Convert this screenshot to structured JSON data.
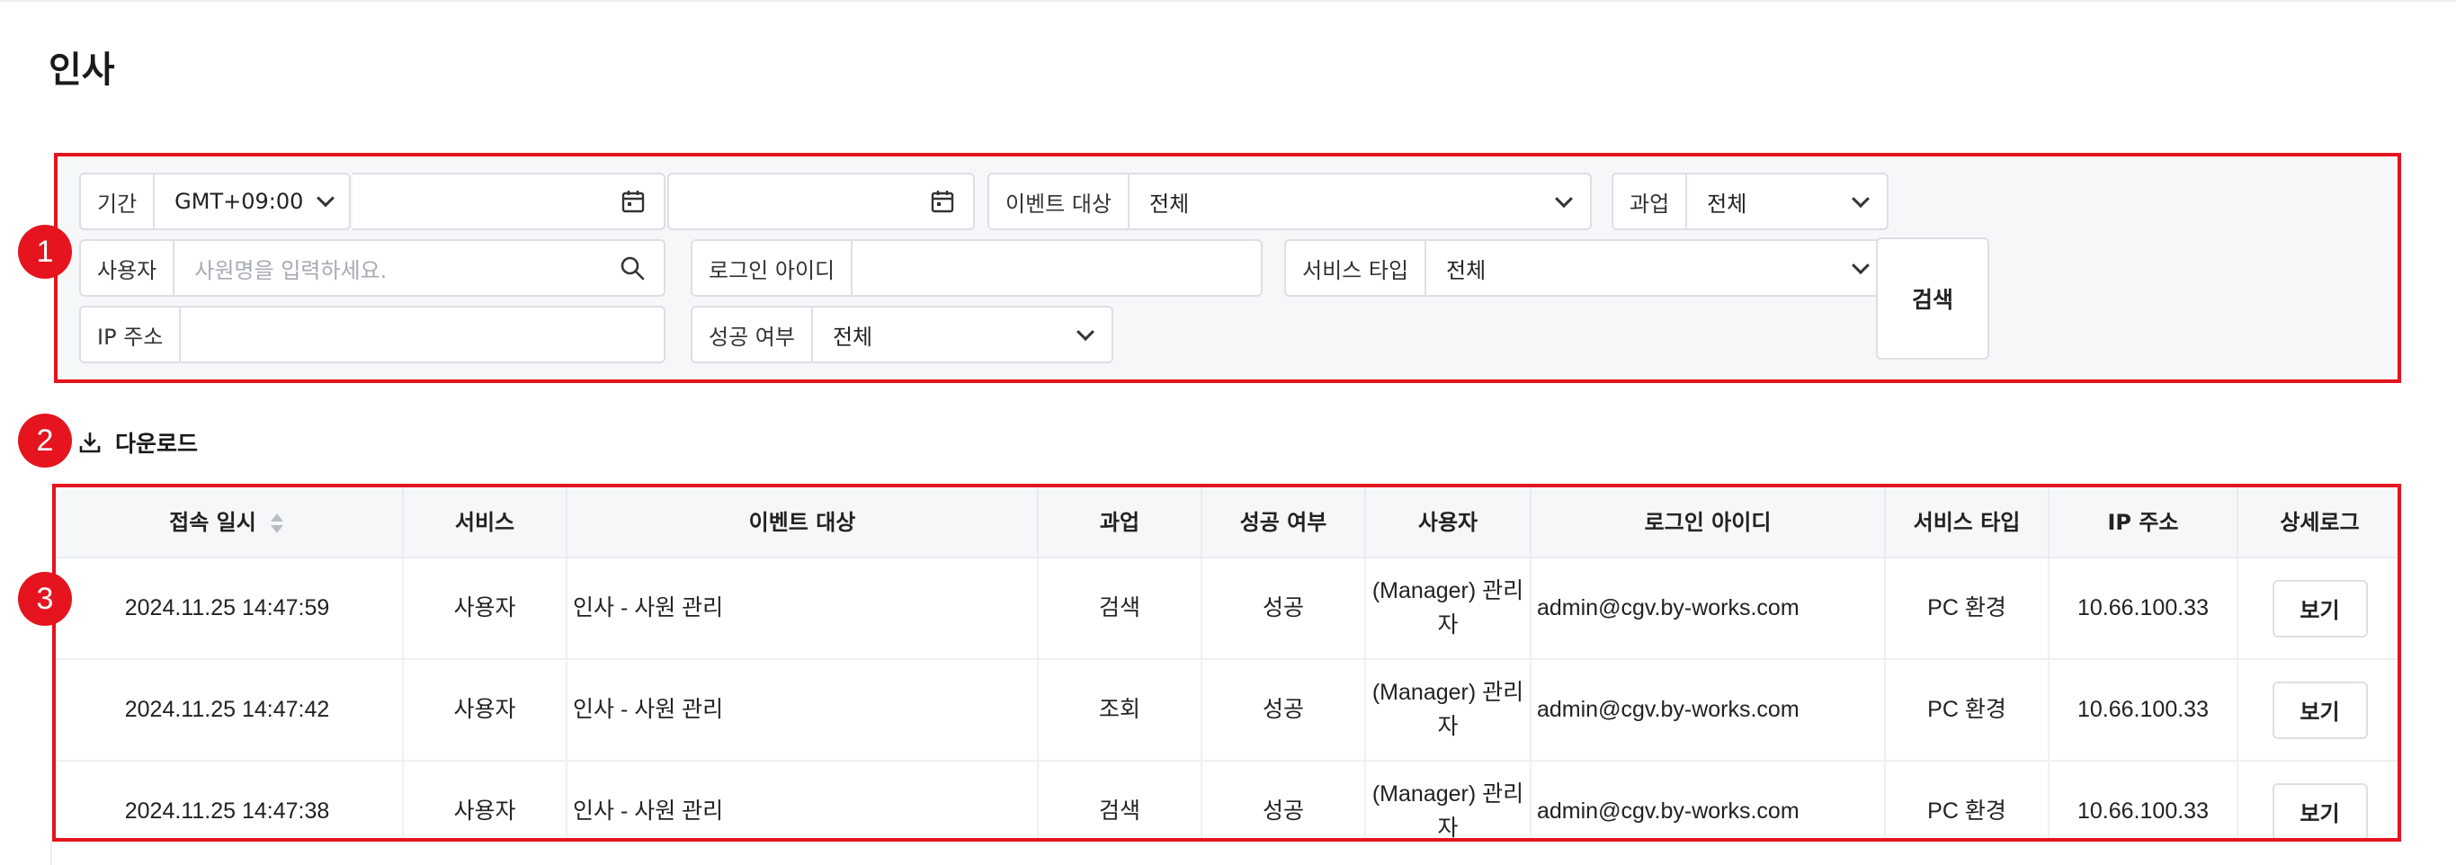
{
  "page": {
    "title": "인사"
  },
  "filters": {
    "period_label": "기간",
    "timezone": "GMT+09:00",
    "date_start": "",
    "date_end": "",
    "range_separator": "~",
    "event_target_label": "이벤트 대상",
    "event_target_value": "전체",
    "task_label": "과업",
    "task_value": "전체",
    "user_label": "사용자",
    "user_placeholder": "사원명을 입력하세요.",
    "login_id_label": "로그인 아이디",
    "login_id_value": "",
    "service_type_label": "서비스 타입",
    "service_type_value": "전체",
    "ip_label": "IP 주소",
    "ip_value": "",
    "success_label": "성공 여부",
    "success_value": "전체",
    "search_button": "검색"
  },
  "markers": [
    "1",
    "2",
    "3"
  ],
  "download": {
    "label": "다운로드",
    "icon": "download-icon"
  },
  "table": {
    "headers": [
      "접속 일시",
      "서비스",
      "이벤트 대상",
      "과업",
      "성공 여부",
      "사용자",
      "로그인 아이디",
      "서비스 타입",
      "IP 주소",
      "상세로그"
    ],
    "rows": [
      {
        "datetime": "2024.11.25 14:47:59",
        "service": "사용자",
        "event_target": "인사 - 사원 관리",
        "task": "검색",
        "success": "성공",
        "user": "(Manager) 관리자",
        "login_id": "admin@cgv.by-works.com",
        "service_type": "PC 환경",
        "ip": "10.66.100.33",
        "detail": "보기"
      },
      {
        "datetime": "2024.11.25 14:47:42",
        "service": "사용자",
        "event_target": "인사 - 사원 관리",
        "task": "조회",
        "success": "성공",
        "user": "(Manager) 관리자",
        "login_id": "admin@cgv.by-works.com",
        "service_type": "PC 환경",
        "ip": "10.66.100.33",
        "detail": "보기"
      },
      {
        "datetime": "2024.11.25 14:47:38",
        "service": "사용자",
        "event_target": "인사 - 사원 관리",
        "task": "검색",
        "success": "성공",
        "user": "(Manager) 관리자",
        "login_id": "admin@cgv.by-works.com",
        "service_type": "PC 환경",
        "ip": "10.66.100.33",
        "detail": "보기"
      }
    ]
  },
  "colors": {
    "highlight": "#e5141e",
    "panel_bg": "#f6f7f9",
    "border": "#dcdfe4"
  }
}
